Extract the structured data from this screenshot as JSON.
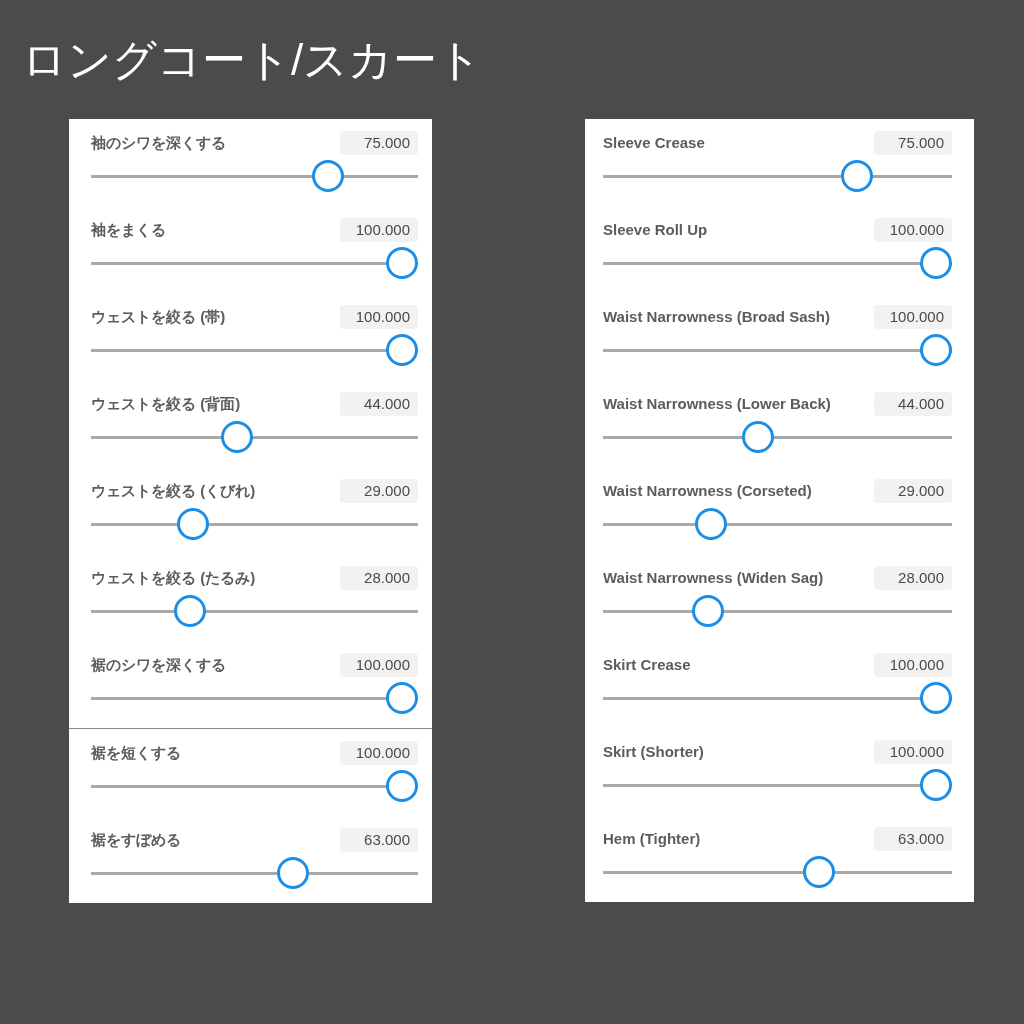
{
  "title": "ロングコート/スカート",
  "columns": [
    {
      "sections": [
        {
          "sliders": [
            {
              "label": "袖のシワを深くする",
              "value": "75.000",
              "level": 0.75
            },
            {
              "label": "袖をまくる",
              "value": "100.000",
              "level": 1
            },
            {
              "label": "ウェストを絞る (帯)",
              "value": "100.000",
              "level": 1
            },
            {
              "label": "ウェストを絞る (背面)",
              "value": "44.000",
              "level": 0.44
            },
            {
              "label": "ウェストを絞る (くびれ)",
              "value": "29.000",
              "level": 0.29
            },
            {
              "label": "ウェストを絞る (たるみ)",
              "value": "28.000",
              "level": 0.28
            },
            {
              "label": "裾のシワを深くする",
              "value": "100.000",
              "level": 1
            }
          ]
        },
        {
          "sliders": [
            {
              "label": "裾を短くする",
              "value": "100.000",
              "level": 1
            },
            {
              "label": "裾をすぼめる",
              "value": "63.000",
              "level": 0.63
            }
          ]
        }
      ]
    },
    {
      "sections": [
        {
          "sliders": [
            {
              "label": "Sleeve Crease",
              "value": "75.000",
              "level": 0.75
            },
            {
              "label": "Sleeve Roll Up",
              "value": "100.000",
              "level": 1
            },
            {
              "label": "Waist Narrowness (Broad Sash)",
              "value": "100.000",
              "level": 1
            },
            {
              "label": "Waist Narrowness (Lower Back)",
              "value": "44.000",
              "level": 0.44
            },
            {
              "label": "Waist Narrowness (Corseted)",
              "value": "29.000",
              "level": 0.29
            },
            {
              "label": "Waist Narrowness (Widen Sag)",
              "value": "28.000",
              "level": 0.28
            },
            {
              "label": "Skirt Crease",
              "value": "100.000",
              "level": 1
            },
            {
              "label": "Skirt (Shorter)",
              "value": "100.000",
              "level": 1
            },
            {
              "label": "Hem (Tighter)",
              "value": "63.000",
              "level": 0.63
            }
          ]
        }
      ]
    }
  ]
}
